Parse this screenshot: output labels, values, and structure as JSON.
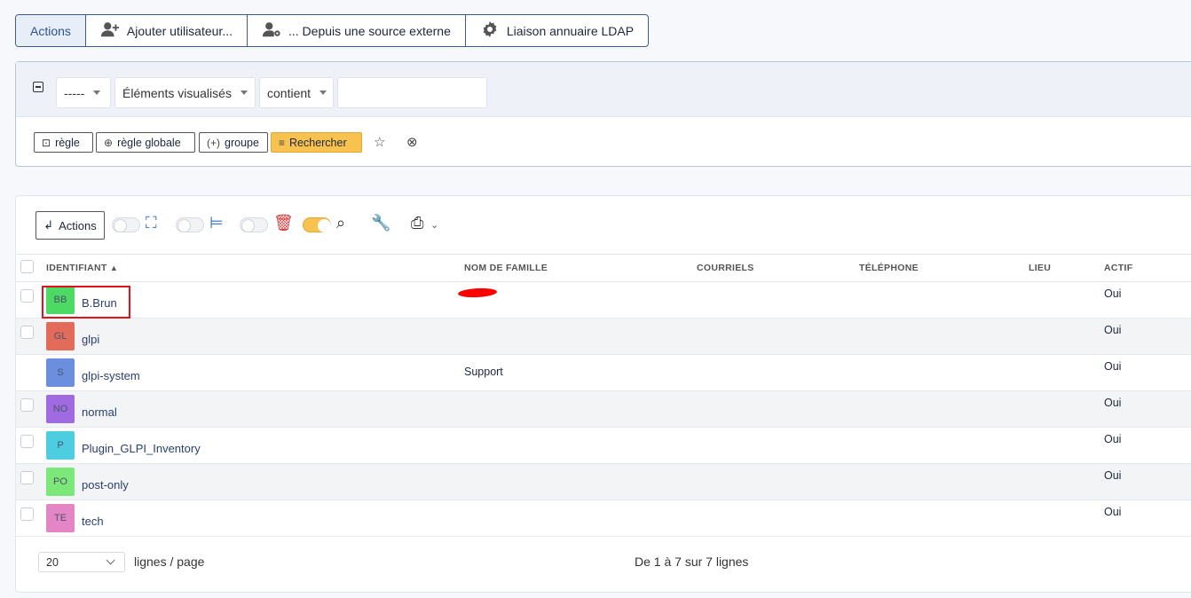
{
  "top_tabs": [
    {
      "label": "Actions",
      "icon": "none"
    },
    {
      "label": "Ajouter utilisateur...",
      "icon": "user-plus-icon"
    },
    {
      "label": "... Depuis une source externe",
      "icon": "user-cog-icon"
    },
    {
      "label": "Liaison annuaire LDAP",
      "icon": "gear-icon"
    }
  ],
  "search": {
    "field1": "-----",
    "field2": "Éléments visualisés",
    "operator": "contient",
    "value": "",
    "btn_rule": "règle",
    "btn_global_rule": "règle globale",
    "btn_group": "groupe",
    "btn_search": "Rechercher"
  },
  "toolbar": {
    "actions_label": "Actions"
  },
  "table": {
    "columns": [
      "IDENTIFIANT",
      "NOM DE FAMILLE",
      "COURRIELS",
      "TÉLÉPHONE",
      "LIEU",
      "ACTIF"
    ],
    "rows": [
      {
        "initials": "BB",
        "color": "#4cd964",
        "login": "B.Brun",
        "lastname": "",
        "active": "Oui",
        "checkbox": true
      },
      {
        "initials": "GL",
        "color": "#e26b5a",
        "login": "glpi",
        "lastname": "",
        "active": "Oui",
        "checkbox": true
      },
      {
        "initials": "S",
        "color": "#6b8fdd",
        "login": "glpi-system",
        "lastname": "Support",
        "active": "Oui",
        "checkbox": false
      },
      {
        "initials": "NO",
        "color": "#a06ae0",
        "login": "normal",
        "lastname": "",
        "active": "Oui",
        "checkbox": true
      },
      {
        "initials": "P",
        "color": "#4fcde0",
        "login": "Plugin_GLPI_Inventory",
        "lastname": "",
        "active": "Oui",
        "checkbox": true
      },
      {
        "initials": "PO",
        "color": "#7de87a",
        "login": "post-only",
        "lastname": "",
        "active": "Oui",
        "checkbox": true
      },
      {
        "initials": "TE",
        "color": "#e486c6",
        "login": "tech",
        "lastname": "",
        "active": "Oui",
        "checkbox": true
      }
    ]
  },
  "footer": {
    "page_size": "20",
    "lines_label": "lignes / page",
    "count_label": "De 1 à 7 sur 7 lignes"
  }
}
